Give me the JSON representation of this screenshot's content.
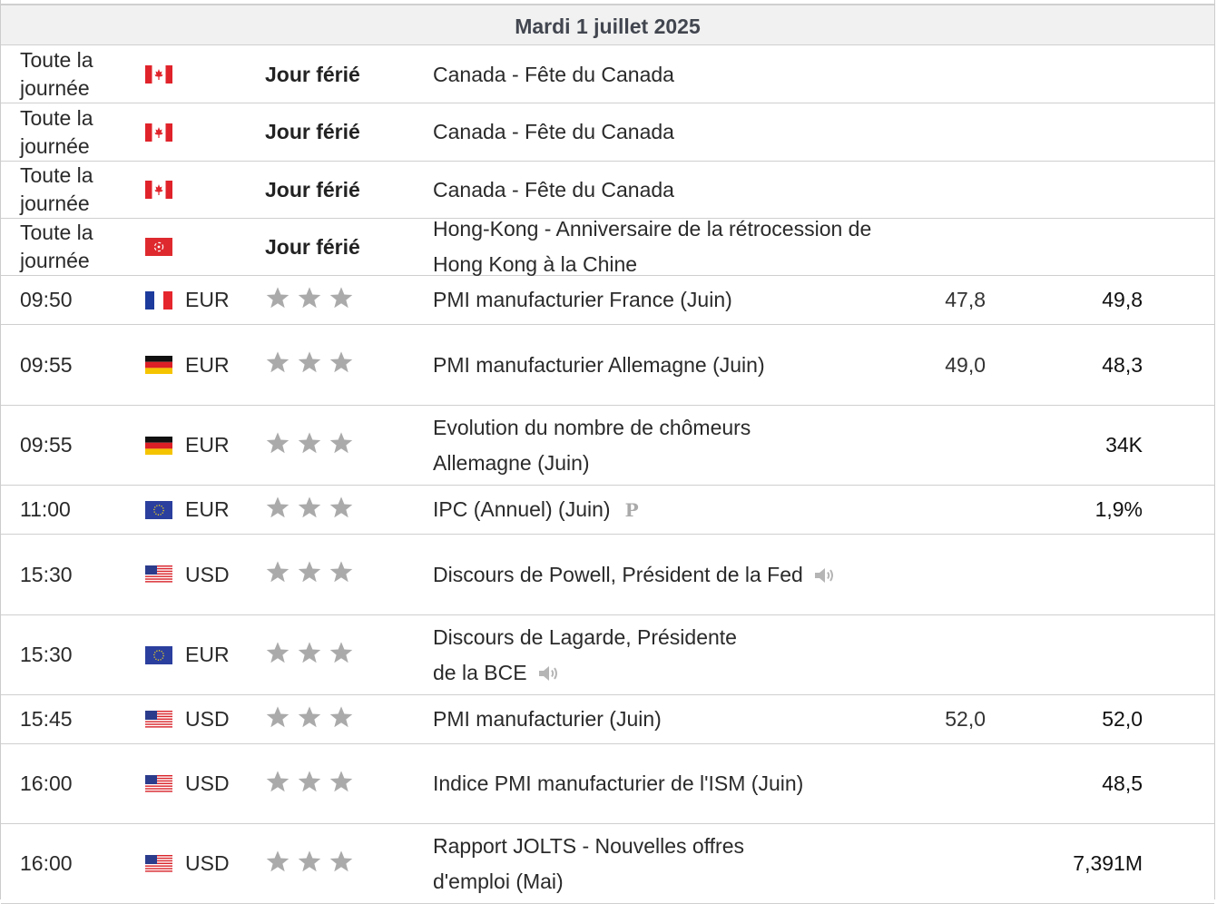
{
  "header": {
    "date": "Mardi 1 juillet 2025"
  },
  "rows": [
    {
      "time": "Toute la journée",
      "flag": "canada-flag-icon",
      "currency": "",
      "holiday": "Jour férié",
      "event": "Canada - Fête du Canada",
      "actual": "",
      "previous": ""
    },
    {
      "time": "Toute la journée",
      "flag": "canada-flag-icon",
      "currency": "",
      "holiday": "Jour férié",
      "event": "Canada - Fête du Canada",
      "actual": "",
      "previous": ""
    },
    {
      "time": "Toute la journée",
      "flag": "canada-flag-icon",
      "currency": "",
      "holiday": "Jour férié",
      "event": "Canada - Fête du Canada",
      "actual": "",
      "previous": ""
    },
    {
      "time": "Toute la journée",
      "flag": "hong-kong-flag-icon",
      "currency": "",
      "holiday": "Jour férié",
      "event": "Hong-Kong - Anniversaire de la rétrocession de Hong Kong à la Chine",
      "actual": "",
      "previous": ""
    },
    {
      "time": "09:50",
      "flag": "france-flag-icon",
      "currency": "EUR",
      "importance": 3,
      "event": "PMI manufacturier France (Juin)",
      "actual": "47,8",
      "previous": "49,8"
    },
    {
      "time": "09:55",
      "flag": "germany-flag-icon",
      "currency": "EUR",
      "importance": 3,
      "event": "PMI manufacturier Allemagne (Juin)",
      "actual": "49,0",
      "previous": "48,3"
    },
    {
      "time": "09:55",
      "flag": "germany-flag-icon",
      "currency": "EUR",
      "importance": 3,
      "event": "Evolution du nombre de chômeurs Allemagne (Juin)",
      "actual": "",
      "previous": "34K"
    },
    {
      "time": "11:00",
      "flag": "eu-flag-icon",
      "currency": "EUR",
      "importance": 3,
      "event": "IPC (Annuel) (Juin)",
      "preliminary_mark": "P",
      "actual": "",
      "previous": "1,9%"
    },
    {
      "time": "15:30",
      "flag": "usa-flag-icon",
      "currency": "USD",
      "importance": 3,
      "event": "Discours de Powell, Président de la Fed",
      "speech": true,
      "actual": "",
      "previous": ""
    },
    {
      "time": "15:30",
      "flag": "eu-flag-icon",
      "currency": "EUR",
      "importance": 3,
      "event": "Discours de Lagarde, Présidente de la BCE",
      "speech": true,
      "actual": "",
      "previous": ""
    },
    {
      "time": "15:45",
      "flag": "usa-flag-icon",
      "currency": "USD",
      "importance": 3,
      "event": "PMI manufacturier (Juin)",
      "actual": "52,0",
      "previous": "52,0"
    },
    {
      "time": "16:00",
      "flag": "usa-flag-icon",
      "currency": "USD",
      "importance": 3,
      "event": "Indice PMI manufacturier de l'ISM (Juin)",
      "actual": "",
      "previous": "48,5"
    },
    {
      "time": "16:00",
      "flag": "usa-flag-icon",
      "currency": "USD",
      "importance": 3,
      "event": "Rapport JOLTS - Nouvelles offres d'emploi (Mai)",
      "actual": "",
      "previous": "7,391M"
    }
  ]
}
